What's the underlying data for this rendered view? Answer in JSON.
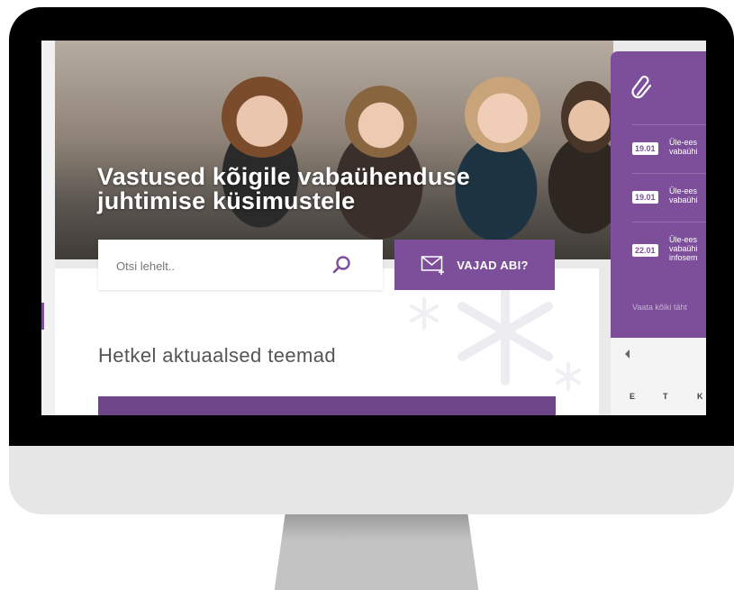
{
  "hero": {
    "title_line1": "Vastused kõigile vabaühenduse",
    "title_line2": "juhtimise küsimustele"
  },
  "search": {
    "placeholder": "Otsi lehelt..",
    "icon": "search-icon"
  },
  "help_button": {
    "label": "VAJAD ABI?",
    "icon": "mail-plus-icon"
  },
  "content": {
    "section_title": "Hetkel aktuaalsed teemad"
  },
  "side_panel": {
    "icon": "paperclip-icon",
    "events": [
      {
        "date": "19.01",
        "line1": "Üle-ees",
        "line2": "vabaühi"
      },
      {
        "date": "19.01",
        "line1": "Üle-ees",
        "line2": "vabaühi"
      },
      {
        "date": "22.01",
        "line1": "Üle-ees",
        "line2": "vabaühi",
        "line3": "infosem"
      }
    ],
    "see_all": "Vaata kõiki täht"
  },
  "calendar": {
    "day_headers": [
      "E",
      "T",
      "K"
    ]
  },
  "colors": {
    "accent": "#7d4f9b",
    "accent_dark": "#6e4588",
    "text_gray": "#555555"
  }
}
